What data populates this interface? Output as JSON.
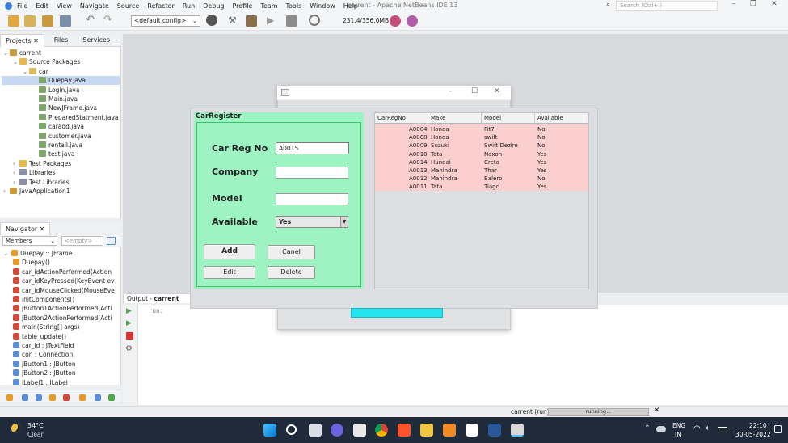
{
  "ide": {
    "title": "carrent - Apache NetBeans IDE 13",
    "menu": [
      "File",
      "Edit",
      "View",
      "Navigate",
      "Source",
      "Refactor",
      "Run",
      "Debug",
      "Profile",
      "Team",
      "Tools",
      "Window",
      "Help"
    ],
    "search_placeholder": "Search (Ctrl+I)",
    "config": "<default config>",
    "memory": "231.4/356.0MB"
  },
  "projects": {
    "tabs": [
      "Projects",
      "Files",
      "Services"
    ],
    "tab_close": "✕",
    "tree": [
      {
        "label": "carrent",
        "depth": 0,
        "icon": "proj",
        "arrow": "⌄"
      },
      {
        "label": "Source Packages",
        "depth": 1,
        "icon": "folder",
        "arrow": "⌄"
      },
      {
        "label": "car",
        "depth": 2,
        "icon": "pkg",
        "arrow": "⌄"
      },
      {
        "label": "Duepay.java",
        "depth": 3,
        "icon": "java",
        "selected": true
      },
      {
        "label": "Login.java",
        "depth": 3,
        "icon": "java"
      },
      {
        "label": "Main.java",
        "depth": 3,
        "icon": "java"
      },
      {
        "label": "NewJFrame.java",
        "depth": 3,
        "icon": "java"
      },
      {
        "label": "PreparedStatment.java",
        "depth": 3,
        "icon": "java"
      },
      {
        "label": "caradd.java",
        "depth": 3,
        "icon": "java"
      },
      {
        "label": "customer.java",
        "depth": 3,
        "icon": "java"
      },
      {
        "label": "rentail.java",
        "depth": 3,
        "icon": "java"
      },
      {
        "label": "test.java",
        "depth": 3,
        "icon": "java"
      },
      {
        "label": "Test Packages",
        "depth": 1,
        "icon": "folder",
        "arrow": "›"
      },
      {
        "label": "Libraries",
        "depth": 1,
        "icon": "lib",
        "arrow": "›"
      },
      {
        "label": "Test Libraries",
        "depth": 1,
        "icon": "lib",
        "arrow": "›"
      },
      {
        "label": "JavaApplication1",
        "depth": 0,
        "icon": "proj",
        "arrow": "›"
      }
    ]
  },
  "navigator": {
    "title": "Navigator",
    "members": "Members",
    "empty": "<empty>",
    "items": [
      {
        "label": "Duepay :: JFrame",
        "depth": 0,
        "icon": "orange"
      },
      {
        "label": "Duepay()",
        "depth": 1,
        "icon": "orange"
      },
      {
        "label": "car_idActionPerformed(Action",
        "depth": 1,
        "icon": "red"
      },
      {
        "label": "car_idKeyPressed(KeyEvent ev",
        "depth": 1,
        "icon": "red"
      },
      {
        "label": "car_idMouseClicked(MouseEve",
        "depth": 1,
        "icon": "red"
      },
      {
        "label": "initComponents()",
        "depth": 1,
        "icon": "red"
      },
      {
        "label": "jButton1ActionPerformed(Acti",
        "depth": 1,
        "icon": "red"
      },
      {
        "label": "jButton2ActionPerformed(Acti",
        "depth": 1,
        "icon": "red"
      },
      {
        "label": "main(String[] args)",
        "depth": 1,
        "icon": "red"
      },
      {
        "label": "table_update()",
        "depth": 1,
        "icon": "red"
      },
      {
        "label": "car_id : JTextField",
        "depth": 1,
        "icon": "blue"
      },
      {
        "label": "con : Connection",
        "depth": 1,
        "icon": "blue"
      },
      {
        "label": "jButton1 : JButton",
        "depth": 1,
        "icon": "blue"
      },
      {
        "label": "jButton2 : JButton",
        "depth": 1,
        "icon": "blue"
      },
      {
        "label": "jLabel1 : JLabel",
        "depth": 1,
        "icon": "blue"
      }
    ]
  },
  "output": {
    "tab_prefix": "Output - ",
    "tab_name": "carrent (run)",
    "tab_close": "✕",
    "run_text": "run:"
  },
  "status": {
    "run_label": "carrent (run)",
    "progress": "running...",
    "close": "✕"
  },
  "form": {
    "title": "CarRegister",
    "car_reg_label": "Car Reg No",
    "car_reg_value": "A0015",
    "company_label": "Company",
    "company_value": "",
    "model_label": "Model",
    "model_value": "",
    "available_label": "Available",
    "available_value": "Yes",
    "add_button": "Add",
    "cancel_button": "Canel",
    "edit_button": "Edit",
    "delete_button": "Delete"
  },
  "table": {
    "headers": [
      "CarRegNo",
      "Make",
      "Model",
      "Available"
    ],
    "rows": [
      [
        "A0004",
        "Honda",
        "Fit7",
        "No"
      ],
      [
        "A0008",
        "Honda",
        "swift",
        "No"
      ],
      [
        "A0009",
        "Suzuki",
        "Swift Dezire",
        "No"
      ],
      [
        "A0010",
        "Tata",
        "Nexon",
        "Yes"
      ],
      [
        "A0014",
        "Hundai",
        "Creta",
        "Yes"
      ],
      [
        "A0013",
        "Mahindra",
        "Thar",
        "Yes"
      ],
      [
        "A0012",
        "Mahindra",
        "Balero",
        "No"
      ],
      [
        "A0011",
        "Tata",
        "Tiago",
        "Yes"
      ]
    ]
  },
  "taskbar": {
    "temp": "34°C",
    "weather": "Clear",
    "lang1": "ENG",
    "lang2": "IN",
    "time": "22:10",
    "date": "30-05-2022"
  },
  "colors": {
    "form_bg": "#9ef3c2",
    "table_rows": "#fccfcf",
    "accent_cyan": "#22e3ee",
    "taskbar": "#1f2a3a"
  }
}
